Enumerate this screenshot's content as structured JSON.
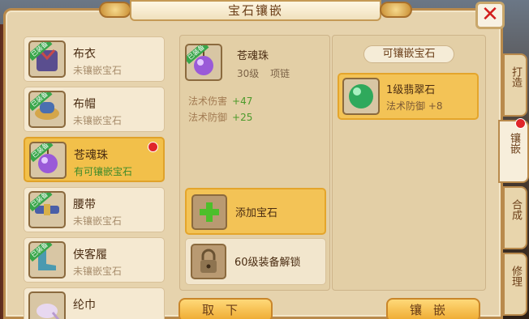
{
  "title": "宝石镶嵌",
  "badge_text": "已装备",
  "items": [
    {
      "name": "布衣",
      "status": "未镶嵌宝石",
      "icon": "cloth-armor-icon",
      "selected": false,
      "dot": false
    },
    {
      "name": "布帽",
      "status": "未镶嵌宝石",
      "icon": "cloth-hat-icon",
      "selected": false,
      "dot": false
    },
    {
      "name": "苍魂珠",
      "status": "有可镶嵌宝石",
      "icon": "soul-orb-icon",
      "selected": true,
      "dot": true
    },
    {
      "name": "腰带",
      "status": "未镶嵌宝石",
      "icon": "belt-icon",
      "selected": false,
      "dot": false
    },
    {
      "name": "侠客履",
      "status": "未镶嵌宝石",
      "icon": "boots-icon",
      "selected": false,
      "dot": false
    },
    {
      "name": "纶巾",
      "status": "",
      "icon": "headscarf-icon",
      "selected": false,
      "dot": false
    }
  ],
  "detail": {
    "name": "苍魂珠",
    "level": "30级",
    "slot": "项链",
    "stats": [
      {
        "label": "法术伤害",
        "value": "+47"
      },
      {
        "label": "法术防御",
        "value": "+25"
      }
    ],
    "add_gem_label": "添加宝石",
    "unlock_label": "60级装备解锁"
  },
  "gems_panel": {
    "header": "可镶嵌宝石",
    "gems": [
      {
        "name": "1级翡翠石",
        "stat": "法术防御",
        "value": "+8",
        "icon": "jade-gem-icon"
      }
    ]
  },
  "buttons": {
    "remove": "取下",
    "inlay": "镶嵌"
  },
  "side_tabs": [
    {
      "label": "打造",
      "active": false,
      "dot": false
    },
    {
      "label": "镶嵌",
      "active": true,
      "dot": true
    },
    {
      "label": "合成",
      "active": false,
      "dot": false
    },
    {
      "label": "修理",
      "active": false,
      "dot": false
    }
  ],
  "colors": {
    "selected_row": "#f2c04a",
    "available_status": "#3d8a2a",
    "stat_value": "#4c9a2b",
    "close_x": "#d21e1e",
    "notify_dot": "#e0262a"
  }
}
